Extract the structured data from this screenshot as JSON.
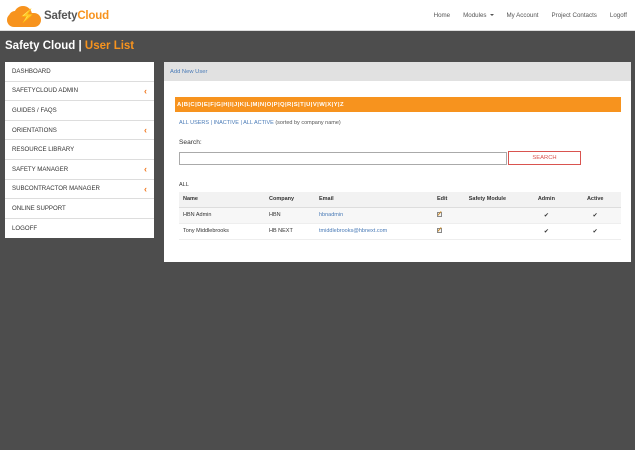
{
  "brand": {
    "name_a": "Safety",
    "name_b": "Cloud"
  },
  "topnav": {
    "home": "Home",
    "modules": "Modules",
    "account": "My Account",
    "contacts": "Project Contacts",
    "logoff": "Logoff"
  },
  "title": {
    "main": "Safety Cloud",
    "sep": "|",
    "sub": "User List"
  },
  "sidebar": {
    "items": [
      {
        "label": "DASHBOARD"
      },
      {
        "label": "SAFETYCLOUD ADMIN"
      },
      {
        "label": "GUIDES / FAQS"
      },
      {
        "label": "ORIENTATIONS"
      },
      {
        "label": "RESOURCE LIBRARY"
      },
      {
        "label": "SAFETY MANAGER"
      },
      {
        "label": "SUBCONTRACTOR MANAGER"
      },
      {
        "label": "ONLINE SUPPORT"
      },
      {
        "label": "LOGOFF"
      }
    ],
    "chevron": "‹"
  },
  "panel": {
    "add_new": "Add New User",
    "letters": [
      "A",
      "B",
      "C",
      "D",
      "E",
      "F",
      "G",
      "H",
      "I",
      "J",
      "K",
      "L",
      "M",
      "N",
      "O",
      "P",
      "Q",
      "R",
      "S",
      "T",
      "U",
      "V",
      "W",
      "X",
      "Y",
      "Z"
    ],
    "filters": {
      "all": "ALL USERS",
      "inactive": "INACTIVE",
      "active": "ALL ACTIVE",
      "sep": "|",
      "note": "(sorted by company name)"
    },
    "search_label": "Search:",
    "search_value": "",
    "search_button": "SEARCH",
    "all_label": "ALL",
    "columns": [
      "Name",
      "Company",
      "Email",
      "Edit",
      "Safety Module",
      "Admin",
      "Active"
    ],
    "rows": [
      {
        "name": "HBN Admin",
        "company": "HBN",
        "email": "hbnadmin",
        "safety_module": "",
        "admin": "✔",
        "active": "✔"
      },
      {
        "name": "Tony Middlebrooks",
        "company": "HB NEXT",
        "email": "tmiddlebrooks@hbnext.com",
        "safety_module": "",
        "admin": "✔",
        "active": "✔"
      }
    ]
  },
  "colors": {
    "accent": "#f7931e",
    "link": "#4a7bb7",
    "danger": "#d9534f",
    "background": "#4d4d4d"
  }
}
